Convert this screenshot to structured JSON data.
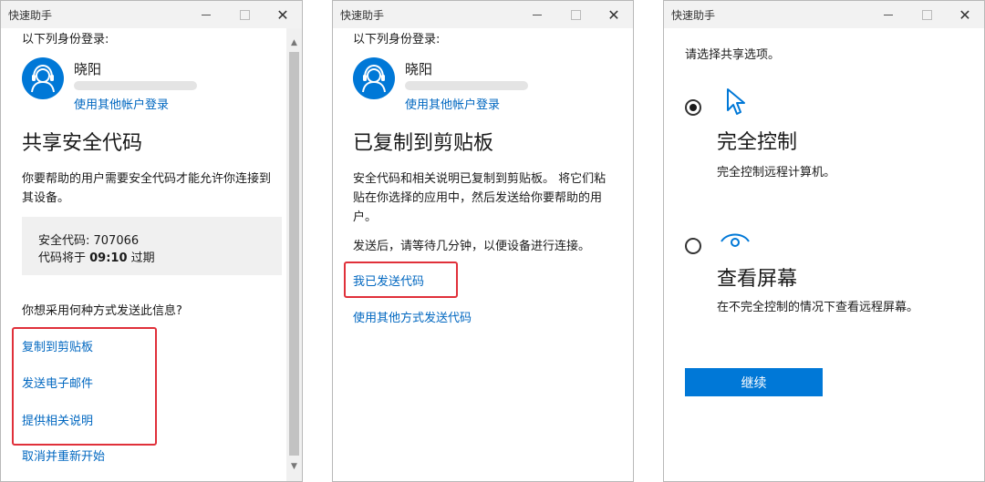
{
  "window_title": "快速助手",
  "window_controls": {
    "minimize": "—",
    "maximize": "□",
    "close": "✕"
  },
  "win1": {
    "signin_label": "以下列身份登录:",
    "user_name": "晓阳",
    "other_account_link": "使用其他帐户登录",
    "heading": "共享安全代码",
    "description": "你要帮助的用户需要安全代码才能允许你连接到其设备。",
    "code_line": "安全代码: 707066",
    "expire_prefix": "代码将于 ",
    "expire_time": "09:10",
    "expire_suffix": " 过期",
    "send_question": "你想采用何种方式发送此信息?",
    "options": [
      "复制到剪贴板",
      "发送电子邮件",
      "提供相关说明"
    ],
    "cancel_link": "取消并重新开始"
  },
  "win2": {
    "signin_label": "以下列身份登录:",
    "user_name": "晓阳",
    "other_account_link": "使用其他帐户登录",
    "heading": "已复制到剪贴板",
    "description": "安全代码和相关说明已复制到剪贴板。 将它们粘贴在你选择的应用中，然后发送给你要帮助的用户。",
    "wait_text": "发送后，请等待几分钟，以便设备进行连接。",
    "sent_link": "我已发送代码",
    "other_method_link": "使用其他方式发送代码"
  },
  "win3": {
    "prompt": "请选择共享选项。",
    "options": [
      {
        "title": "完全控制",
        "desc": "完全控制远程计算机。",
        "selected": true,
        "icon": "cursor-icon"
      },
      {
        "title": "查看屏幕",
        "desc": "在不完全控制的情况下查看远程屏幕。",
        "selected": false,
        "icon": "eye-icon"
      }
    ],
    "continue_button": "继续"
  },
  "colors": {
    "accent": "#0078d7",
    "link": "#0067c0",
    "highlight": "#e0303a"
  }
}
